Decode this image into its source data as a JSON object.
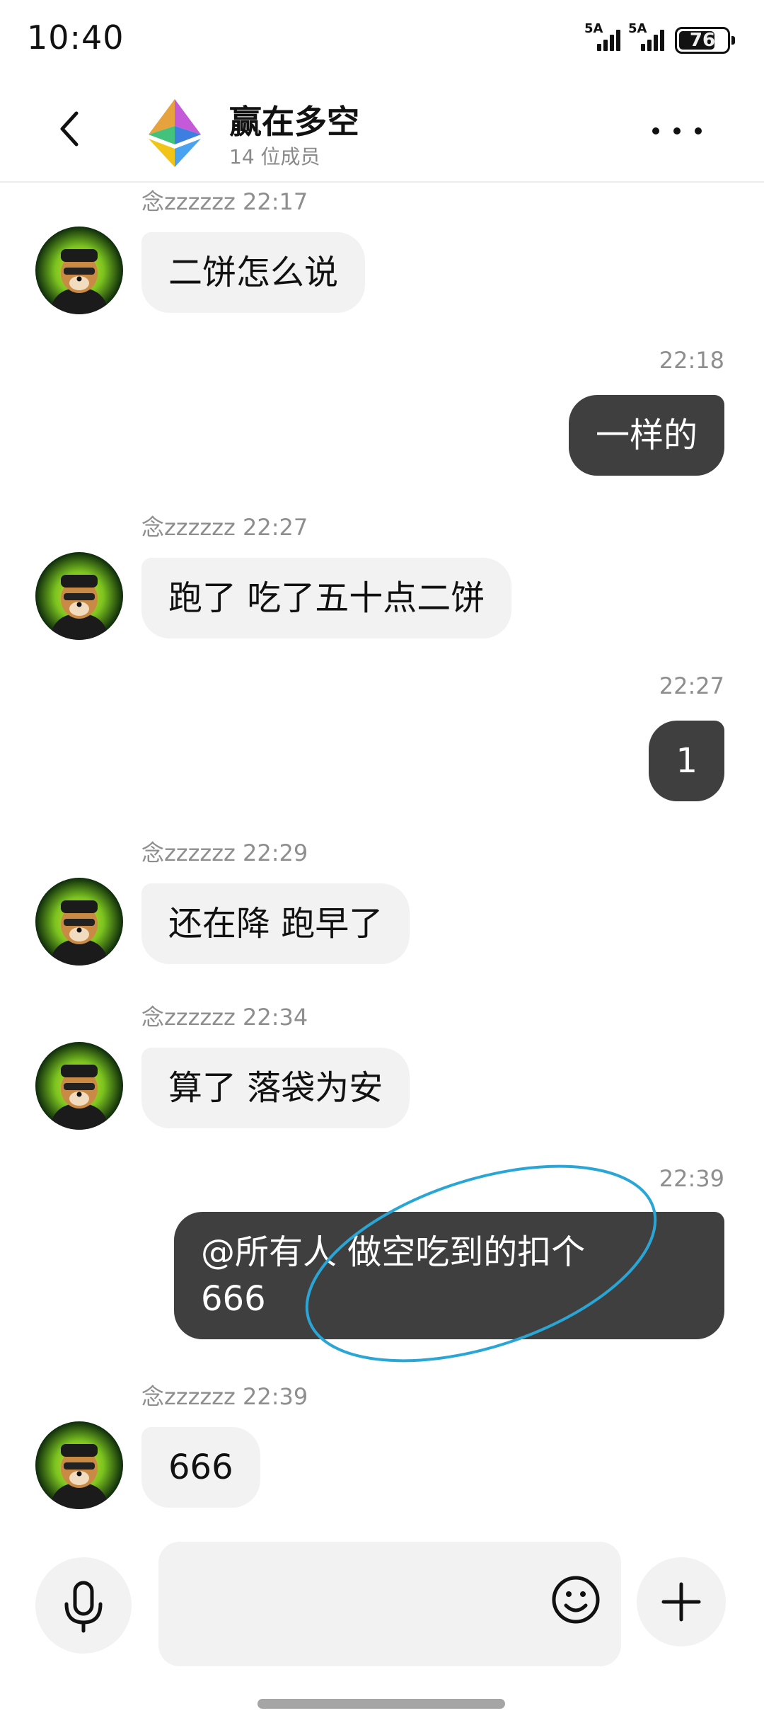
{
  "status_bar": {
    "time": "10:40",
    "signal_1_label": "5A",
    "signal_2_label": "5A",
    "battery_level": "76",
    "battery_fraction": 0.76
  },
  "header": {
    "group_name": "赢在多空",
    "member_count": "14 位成员",
    "back_icon": "chevron-left-icon",
    "more_icon": "more-horizontal-icon"
  },
  "messages": [
    {
      "direction": "in",
      "sender": "念zzzzzz",
      "time": "22:17",
      "text": "二饼怎么说"
    },
    {
      "direction": "out",
      "time": "22:18",
      "text": "一样的"
    },
    {
      "direction": "in",
      "sender": "念zzzzzz",
      "time": "22:27",
      "text": "跑了 吃了五十点二饼"
    },
    {
      "direction": "out",
      "time": "22:27",
      "text": "1"
    },
    {
      "direction": "in",
      "sender": "念zzzzzz",
      "time": "22:29",
      "text": "还在降 跑早了"
    },
    {
      "direction": "in",
      "sender": "念zzzzzz",
      "time": "22:34",
      "text": "算了 落袋为安"
    },
    {
      "direction": "out",
      "time": "22:39",
      "text": "@所有人 做空吃到的扣个\n666"
    },
    {
      "direction": "in",
      "sender": "念zzzzzz",
      "time": "22:39",
      "text": "666"
    }
  ],
  "input_bar": {
    "placeholder": "",
    "mic_icon": "microphone-icon",
    "emoji_icon": "smiley-icon",
    "plus_icon": "plus-icon"
  },
  "colors": {
    "outgoing_bubble": "#3f3f3f",
    "incoming_bubble": "#f2f2f2",
    "annotation_circle": "#2aa6d6"
  }
}
